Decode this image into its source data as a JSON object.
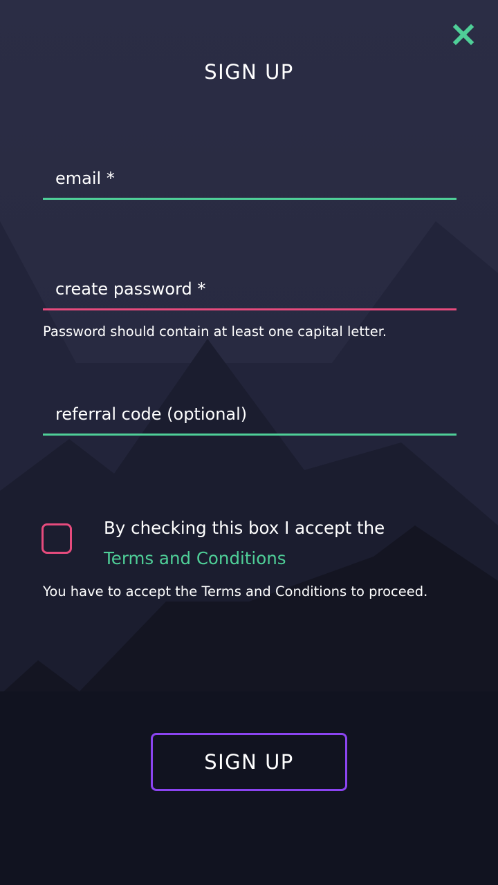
{
  "colors": {
    "accent_green": "#4fcf98",
    "error_pink": "#e64b7d",
    "button_purple": "#8b44f0",
    "background_dark": "#13141f"
  },
  "header": {
    "title": "SIGN UP",
    "close_icon": "close-icon"
  },
  "form": {
    "email": {
      "placeholder": "email *",
      "value": ""
    },
    "password": {
      "placeholder": "create password *",
      "value": "",
      "hint": "Password should contain at least one capital letter."
    },
    "referral": {
      "placeholder": "referral code (optional)",
      "value": ""
    },
    "terms": {
      "checked": false,
      "label": "By checking this box I accept the",
      "link": "Terms and Conditions",
      "hint": "You have to accept the Terms and Conditions to proceed."
    },
    "submit_label": "SIGN UP"
  }
}
